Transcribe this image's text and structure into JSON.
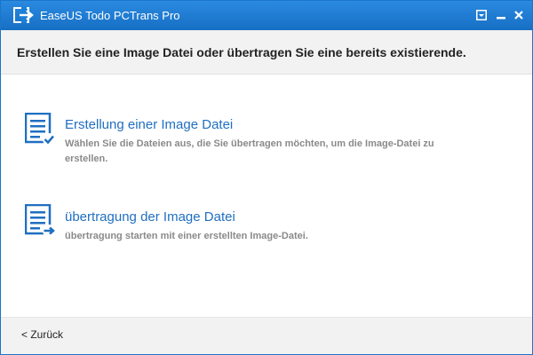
{
  "window": {
    "title": "EaseUS Todo PCTrans Pro",
    "titlebar_color": "#1d7fd6",
    "icons": [
      "app-logo-icon",
      "menu-dropdown-icon",
      "minimize-icon",
      "close-icon"
    ]
  },
  "header": {
    "text": "Erstellen Sie eine Image Datei oder übertragen Sie eine bereits existierende."
  },
  "options": [
    {
      "title": "Erstellung einer Image Datei",
      "description": "Wählen Sie die Dateien aus, die Sie übertragen möchten, um die Image-Datei zu erstellen.",
      "icon": "document-check-icon"
    },
    {
      "title": "übertragung der Image Datei",
      "description": "übertragung starten mit einer erstellten Image-Datei.",
      "icon": "document-arrow-icon"
    }
  ],
  "accent_color": "#1f6fc1",
  "footer": {
    "back_label": "< Zurück"
  }
}
